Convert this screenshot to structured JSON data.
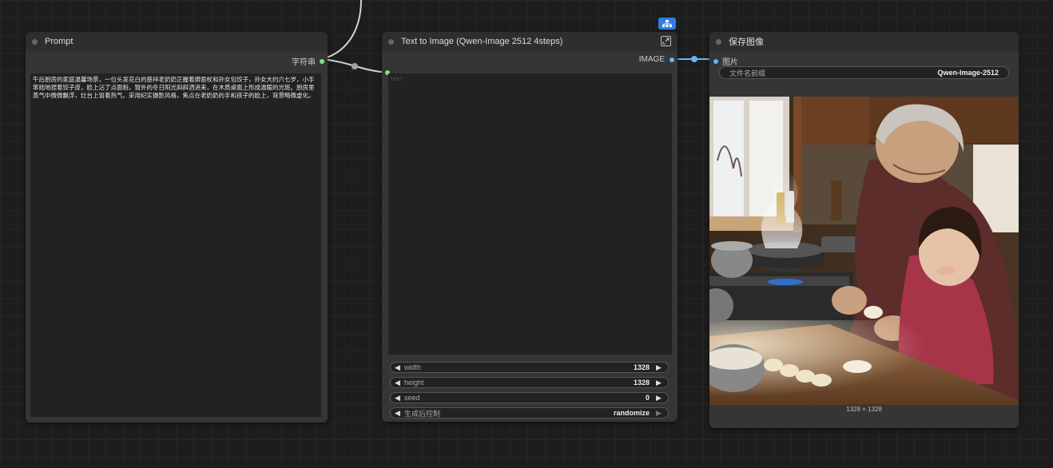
{
  "prompt_node": {
    "title": "Prompt",
    "output_label": "字符串",
    "text": "午后厨房的家庭温馨场景，一位头发花白的慈祥老奶奶正握着擀面杖和孙女包饺子，孙女大约六七岁，小手笨拙地捏着饺子皮，脸上沾了点面粉。窗外的冬日阳光斜斜洒进来，在木质桌面上形成温暖的光斑。厨房里蒸气中微微飘浮，灶台上冒着热气。采用纪实摄影风格，焦点在老奶奶的手和孩子的脸上，背景略微虚化。"
  },
  "t2i_node": {
    "title": "Text to Image (Qwen-Image 2512 4steps)",
    "output_label": "IMAGE",
    "text_placeholder": "text",
    "widgets": [
      {
        "label": "width",
        "value": "1328"
      },
      {
        "label": "height",
        "value": "1328"
      },
      {
        "label": "seed",
        "value": "0"
      },
      {
        "label": "生成后控制",
        "value": "randomize"
      }
    ]
  },
  "save_node": {
    "title": "保存图像",
    "input_label": "图片",
    "prefix_label": "文件名前缀",
    "prefix_value": "Qwen-Image-2512",
    "image_size": "1328 × 1328"
  },
  "colors": {
    "string_slot": "#7de38a",
    "image_slot": "#64b5f6",
    "badge": "#2f7fe0"
  }
}
